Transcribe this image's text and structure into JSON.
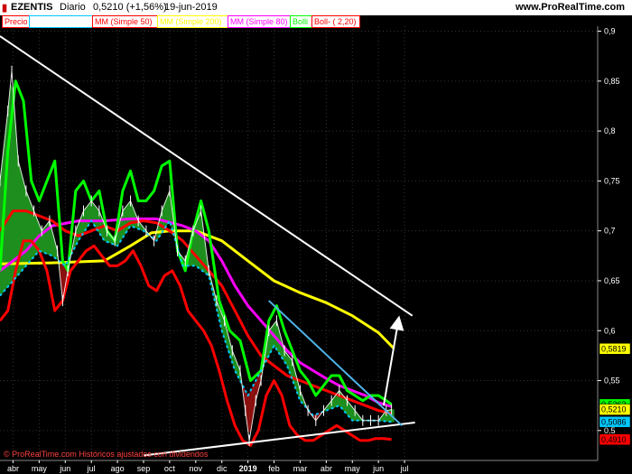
{
  "header": {
    "symbol": "EZENTIS",
    "period": "Diario",
    "price": "0,5210 (+1,56%)",
    "date": "19-jun-2019",
    "website": "www.ProRealTime.com"
  },
  "legend": [
    {
      "label": "Precio",
      "color": "#ff0000"
    },
    {
      "label": "",
      "color": "#00c8ff"
    },
    {
      "label": "MM (Simple 50)",
      "color": "#ff0000"
    },
    {
      "label": "MM (Simple 200)",
      "color": "#ffff00"
    },
    {
      "label": "MM (Simple 80)",
      "color": "#ff00ff"
    },
    {
      "label": "Bolli",
      "color": "#00ff00"
    },
    {
      "label": "Boll- ( 2,20)",
      "color": "#ff0000"
    }
  ],
  "footer": {
    "copyright": "© ProRealTime.com  Históricos ajustados con dividendos"
  },
  "price_tags": [
    {
      "text": "0,5819",
      "value": 0.5819,
      "bg": "#ffff00",
      "fg": "#000000"
    },
    {
      "text": "0,5262",
      "value": 0.5262,
      "bg": "#00ff00",
      "fg": "#000000"
    },
    {
      "text": "0,5210",
      "value": 0.521,
      "bg": "#ffff00",
      "fg": "#000000"
    },
    {
      "text": "0,5086",
      "value": 0.5086,
      "bg": "#00c8ff",
      "fg": "#000000"
    },
    {
      "text": "0,4910",
      "value": 0.491,
      "bg": "#ff0000",
      "fg": "#000000"
    }
  ],
  "chart_data": {
    "type": "line",
    "yaxis_ticks": [
      0.9,
      0.85,
      0.8,
      0.75,
      0.7,
      0.65,
      0.6,
      0.55,
      0.5
    ],
    "ylim": [
      0.47,
      0.905
    ],
    "xlim": [
      0,
      22.9
    ],
    "x_ticks": [
      {
        "label": "abr",
        "t": 0.5
      },
      {
        "label": "may",
        "t": 1.5
      },
      {
        "label": "jun",
        "t": 2.5
      },
      {
        "label": "jul",
        "t": 3.5
      },
      {
        "label": "ago",
        "t": 4.5
      },
      {
        "label": "sep",
        "t": 5.5
      },
      {
        "label": "oct",
        "t": 6.5
      },
      {
        "label": "nov",
        "t": 7.5
      },
      {
        "label": "dic",
        "t": 8.5
      },
      {
        "label": "2019",
        "t": 9.5
      },
      {
        "label": "feb",
        "t": 10.5
      },
      {
        "label": "mar",
        "t": 11.5
      },
      {
        "label": "abr",
        "t": 12.5
      },
      {
        "label": "may",
        "t": 13.5
      },
      {
        "label": "jun",
        "t": 14.5
      },
      {
        "label": "jul",
        "t": 15.5
      }
    ],
    "series": [
      {
        "name": "Precio",
        "color": "#ffffff",
        "values": [
          [
            0.0,
            0.75
          ],
          [
            0.3,
            0.82
          ],
          [
            0.45,
            0.86
          ],
          [
            0.7,
            0.77
          ],
          [
            1.0,
            0.74
          ],
          [
            1.3,
            0.72
          ],
          [
            1.6,
            0.7
          ],
          [
            1.9,
            0.71
          ],
          [
            2.2,
            0.68
          ],
          [
            2.4,
            0.63
          ],
          [
            2.6,
            0.66
          ],
          [
            2.9,
            0.7
          ],
          [
            3.2,
            0.72
          ],
          [
            3.5,
            0.73
          ],
          [
            3.8,
            0.72
          ],
          [
            4.1,
            0.7
          ],
          [
            4.4,
            0.69
          ],
          [
            4.7,
            0.72
          ],
          [
            5.0,
            0.73
          ],
          [
            5.3,
            0.71
          ],
          [
            5.6,
            0.7
          ],
          [
            5.9,
            0.69
          ],
          [
            6.2,
            0.72
          ],
          [
            6.5,
            0.74
          ],
          [
            6.8,
            0.68
          ],
          [
            7.1,
            0.67
          ],
          [
            7.4,
            0.7
          ],
          [
            7.7,
            0.72
          ],
          [
            8.0,
            0.66
          ],
          [
            8.3,
            0.63
          ],
          [
            8.6,
            0.61
          ],
          [
            8.9,
            0.58
          ],
          [
            9.2,
            0.56
          ],
          [
            9.4,
            0.52
          ],
          [
            9.55,
            0.49
          ],
          [
            9.8,
            0.53
          ],
          [
            10.0,
            0.55
          ],
          [
            10.3,
            0.6
          ],
          [
            10.6,
            0.61
          ],
          [
            10.9,
            0.58
          ],
          [
            11.2,
            0.57
          ],
          [
            11.5,
            0.54
          ],
          [
            11.8,
            0.52
          ],
          [
            12.1,
            0.51
          ],
          [
            12.4,
            0.52
          ],
          [
            12.7,
            0.53
          ],
          [
            13.0,
            0.54
          ],
          [
            13.3,
            0.53
          ],
          [
            13.6,
            0.52
          ],
          [
            13.9,
            0.51
          ],
          [
            14.2,
            0.51
          ],
          [
            14.5,
            0.51
          ],
          [
            14.8,
            0.52
          ],
          [
            15.0,
            0.521
          ]
        ]
      },
      {
        "name": "MM (Simple 200)",
        "color": "#ffff00",
        "values": [
          [
            0.0,
            0.667
          ],
          [
            2.0,
            0.668
          ],
          [
            4.0,
            0.67
          ],
          [
            5.0,
            0.685
          ],
          [
            5.8,
            0.698
          ],
          [
            6.5,
            0.7
          ],
          [
            7.5,
            0.7
          ],
          [
            8.5,
            0.69
          ],
          [
            9.5,
            0.67
          ],
          [
            10.5,
            0.65
          ],
          [
            11.5,
            0.638
          ],
          [
            12.5,
            0.628
          ],
          [
            13.5,
            0.615
          ],
          [
            14.5,
            0.598
          ],
          [
            15.1,
            0.582
          ]
        ]
      },
      {
        "name": "MM (Simple 80)",
        "color": "#ff00ff",
        "values": [
          [
            0.0,
            0.66
          ],
          [
            0.5,
            0.67
          ],
          [
            1.0,
            0.68
          ],
          [
            1.5,
            0.695
          ],
          [
            2.0,
            0.705
          ],
          [
            3.0,
            0.71
          ],
          [
            4.0,
            0.71
          ],
          [
            5.0,
            0.712
          ],
          [
            6.0,
            0.712
          ],
          [
            7.0,
            0.705
          ],
          [
            7.5,
            0.7
          ],
          [
            8.0,
            0.69
          ],
          [
            8.5,
            0.67
          ],
          [
            9.0,
            0.645
          ],
          [
            9.5,
            0.625
          ],
          [
            10.0,
            0.61
          ],
          [
            10.5,
            0.595
          ],
          [
            11.0,
            0.58
          ],
          [
            11.5,
            0.568
          ],
          [
            12.0,
            0.56
          ],
          [
            12.5,
            0.552
          ],
          [
            13.0,
            0.545
          ],
          [
            13.5,
            0.54
          ],
          [
            14.0,
            0.535
          ],
          [
            14.5,
            0.528
          ],
          [
            15.0,
            0.524
          ]
        ]
      },
      {
        "name": "MM (Simple 50)",
        "color": "#ff0000",
        "values": [
          [
            0.0,
            0.7
          ],
          [
            0.5,
            0.72
          ],
          [
            1.0,
            0.72
          ],
          [
            1.5,
            0.715
          ],
          [
            2.0,
            0.71
          ],
          [
            2.5,
            0.7
          ],
          [
            3.0,
            0.695
          ],
          [
            3.5,
            0.7
          ],
          [
            4.0,
            0.705
          ],
          [
            4.5,
            0.7
          ],
          [
            5.0,
            0.708
          ],
          [
            5.5,
            0.71
          ],
          [
            6.0,
            0.708
          ],
          [
            6.5,
            0.7
          ],
          [
            7.0,
            0.69
          ],
          [
            7.5,
            0.675
          ],
          [
            8.0,
            0.66
          ],
          [
            8.5,
            0.645
          ],
          [
            9.0,
            0.62
          ],
          [
            9.5,
            0.595
          ],
          [
            10.0,
            0.575
          ],
          [
            10.5,
            0.565
          ],
          [
            11.0,
            0.555
          ],
          [
            11.5,
            0.55
          ],
          [
            12.0,
            0.545
          ],
          [
            12.5,
            0.54
          ],
          [
            13.0,
            0.535
          ],
          [
            13.5,
            0.53
          ],
          [
            14.0,
            0.525
          ],
          [
            14.5,
            0.52
          ],
          [
            15.0,
            0.517
          ]
        ]
      },
      {
        "name": "Bolli",
        "color": "#00ff00",
        "values": [
          [
            0.0,
            0.66
          ],
          [
            0.3,
            0.78
          ],
          [
            0.6,
            0.85
          ],
          [
            0.9,
            0.83
          ],
          [
            1.2,
            0.75
          ],
          [
            1.5,
            0.73
          ],
          [
            1.8,
            0.75
          ],
          [
            2.1,
            0.77
          ],
          [
            2.4,
            0.67
          ],
          [
            2.6,
            0.66
          ],
          [
            2.9,
            0.74
          ],
          [
            3.2,
            0.75
          ],
          [
            3.5,
            0.73
          ],
          [
            3.8,
            0.74
          ],
          [
            4.1,
            0.7
          ],
          [
            4.4,
            0.69
          ],
          [
            4.7,
            0.74
          ],
          [
            5.0,
            0.76
          ],
          [
            5.3,
            0.73
          ],
          [
            5.6,
            0.73
          ],
          [
            5.9,
            0.74
          ],
          [
            6.2,
            0.765
          ],
          [
            6.5,
            0.77
          ],
          [
            6.8,
            0.68
          ],
          [
            7.1,
            0.66
          ],
          [
            7.4,
            0.7
          ],
          [
            7.7,
            0.73
          ],
          [
            8.0,
            0.7
          ],
          [
            8.4,
            0.63
          ],
          [
            8.8,
            0.6
          ],
          [
            9.2,
            0.59
          ],
          [
            9.6,
            0.55
          ],
          [
            10.0,
            0.56
          ],
          [
            10.3,
            0.61
          ],
          [
            10.6,
            0.625
          ],
          [
            10.9,
            0.6
          ],
          [
            11.2,
            0.58
          ],
          [
            11.5,
            0.56
          ],
          [
            11.8,
            0.55
          ],
          [
            12.1,
            0.535
          ],
          [
            12.4,
            0.545
          ],
          [
            12.7,
            0.555
          ],
          [
            13.0,
            0.555
          ],
          [
            13.3,
            0.54
          ],
          [
            13.6,
            0.535
          ],
          [
            13.9,
            0.53
          ],
          [
            14.2,
            0.535
          ],
          [
            14.5,
            0.535
          ],
          [
            14.8,
            0.53
          ],
          [
            15.0,
            0.5262
          ]
        ]
      },
      {
        "name": "Boll- ( 2,20)",
        "color": "#ff0000",
        "values": [
          [
            0.0,
            0.61
          ],
          [
            0.3,
            0.62
          ],
          [
            0.6,
            0.66
          ],
          [
            0.9,
            0.69
          ],
          [
            1.2,
            0.69
          ],
          [
            1.5,
            0.68
          ],
          [
            1.8,
            0.66
          ],
          [
            2.1,
            0.62
          ],
          [
            2.4,
            0.63
          ],
          [
            2.7,
            0.66
          ],
          [
            3.0,
            0.67
          ],
          [
            3.3,
            0.68
          ],
          [
            3.6,
            0.685
          ],
          [
            3.9,
            0.675
          ],
          [
            4.2,
            0.665
          ],
          [
            4.5,
            0.665
          ],
          [
            4.8,
            0.67
          ],
          [
            5.1,
            0.68
          ],
          [
            5.4,
            0.665
          ],
          [
            5.7,
            0.645
          ],
          [
            6.0,
            0.64
          ],
          [
            6.3,
            0.655
          ],
          [
            6.6,
            0.66
          ],
          [
            6.9,
            0.645
          ],
          [
            7.2,
            0.62
          ],
          [
            7.5,
            0.61
          ],
          [
            7.8,
            0.6
          ],
          [
            8.1,
            0.585
          ],
          [
            8.4,
            0.56
          ],
          [
            8.7,
            0.53
          ],
          [
            9.0,
            0.505
          ],
          [
            9.3,
            0.49
          ],
          [
            9.6,
            0.485
          ],
          [
            9.9,
            0.5
          ],
          [
            10.2,
            0.535
          ],
          [
            10.5,
            0.55
          ],
          [
            10.8,
            0.535
          ],
          [
            11.1,
            0.505
          ],
          [
            11.4,
            0.495
          ],
          [
            11.7,
            0.49
          ],
          [
            12.0,
            0.49
          ],
          [
            12.3,
            0.495
          ],
          [
            12.6,
            0.5
          ],
          [
            12.9,
            0.505
          ],
          [
            13.2,
            0.5
          ],
          [
            13.5,
            0.495
          ],
          [
            13.8,
            0.49
          ],
          [
            14.1,
            0.49
          ],
          [
            14.4,
            0.492
          ],
          [
            14.7,
            0.492
          ],
          [
            15.0,
            0.491
          ]
        ]
      },
      {
        "name": "",
        "color": "#00c8ff",
        "values": [
          [
            0.0,
            0.635
          ],
          [
            0.5,
            0.65
          ],
          [
            1.0,
            0.665
          ],
          [
            1.5,
            0.68
          ],
          [
            2.0,
            0.675
          ],
          [
            2.5,
            0.665
          ],
          [
            3.0,
            0.69
          ],
          [
            3.5,
            0.71
          ],
          [
            4.0,
            0.69
          ],
          [
            4.5,
            0.685
          ],
          [
            5.0,
            0.705
          ],
          [
            5.5,
            0.7
          ],
          [
            6.0,
            0.69
          ],
          [
            6.5,
            0.71
          ],
          [
            7.0,
            0.665
          ],
          [
            7.5,
            0.665
          ],
          [
            8.0,
            0.655
          ],
          [
            8.5,
            0.6
          ],
          [
            9.0,
            0.56
          ],
          [
            9.5,
            0.535
          ],
          [
            10.0,
            0.56
          ],
          [
            10.5,
            0.585
          ],
          [
            11.0,
            0.565
          ],
          [
            11.5,
            0.53
          ],
          [
            12.0,
            0.515
          ],
          [
            12.5,
            0.52
          ],
          [
            13.0,
            0.525
          ],
          [
            13.5,
            0.51
          ],
          [
            14.0,
            0.51
          ],
          [
            14.5,
            0.51
          ],
          [
            15.0,
            0.5086
          ]
        ]
      }
    ],
    "trendlines": [
      {
        "color": "#ffffff",
        "from": [
          0.0,
          0.895
        ],
        "to": [
          15.8,
          0.615
        ]
      },
      {
        "color": "#ffffff",
        "from": [
          5.5,
          0.475
        ],
        "to": [
          15.9,
          0.508
        ]
      },
      {
        "color": "#4fb4e8",
        "from": [
          10.3,
          0.63
        ],
        "to": [
          15.4,
          0.505
        ]
      },
      {
        "color": "#ffffff",
        "from": [
          14.7,
          0.525
        ],
        "to": [
          15.25,
          0.608
        ],
        "arrow": true
      }
    ]
  }
}
